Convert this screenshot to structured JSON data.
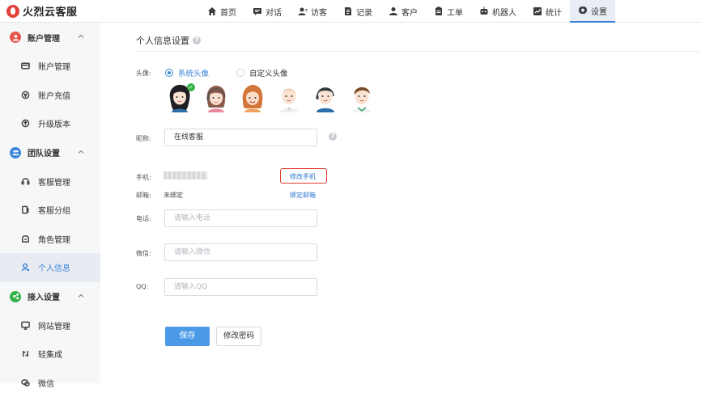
{
  "app": {
    "name": "火烈云客服"
  },
  "nav": [
    {
      "id": "home",
      "label": "首页",
      "icon": "home-icon"
    },
    {
      "id": "chat",
      "label": "对话",
      "icon": "chat-icon"
    },
    {
      "id": "visitor",
      "label": "访客",
      "icon": "visitor-icon"
    },
    {
      "id": "record",
      "label": "记录",
      "icon": "record-icon"
    },
    {
      "id": "customer",
      "label": "客户",
      "icon": "customer-icon"
    },
    {
      "id": "ticket",
      "label": "工单",
      "icon": "ticket-icon"
    },
    {
      "id": "robot",
      "label": "机器人",
      "icon": "robot-icon"
    },
    {
      "id": "stats",
      "label": "统计",
      "icon": "stats-icon"
    },
    {
      "id": "settings",
      "label": "设置",
      "icon": "gear-icon",
      "active": true
    }
  ],
  "sidebar": {
    "groups": [
      {
        "label": "账户管理",
        "icon": "account-icon",
        "color": "#e8574d",
        "items": [
          {
            "label": "账户管理",
            "icon": "card-icon"
          },
          {
            "label": "账户充值",
            "icon": "recharge-icon"
          },
          {
            "label": "升级版本",
            "icon": "upgrade-icon"
          }
        ]
      },
      {
        "label": "团队设置",
        "icon": "team-icon",
        "color": "#3b85d8",
        "items": [
          {
            "label": "客服管理",
            "icon": "headset-icon"
          },
          {
            "label": "客服分组",
            "icon": "group-icon"
          },
          {
            "label": "角色管理",
            "icon": "role-icon"
          },
          {
            "label": "个人信息",
            "icon": "person-icon",
            "active": true
          }
        ]
      },
      {
        "label": "接入设置",
        "icon": "access-icon",
        "color": "#35b34a",
        "items": [
          {
            "label": "网站管理",
            "icon": "website-icon"
          },
          {
            "label": "轻集成",
            "icon": "integration-icon"
          },
          {
            "label": "微信",
            "icon": "wechat-icon"
          }
        ]
      }
    ]
  },
  "page": {
    "title": "个人信息设置",
    "avatar_label": "头像:",
    "avatar_options": {
      "system": "系统头像",
      "custom": "自定义头像"
    },
    "avatars": [
      "avatar-1",
      "avatar-2",
      "avatar-3",
      "avatar-4",
      "avatar-5",
      "avatar-6"
    ],
    "nickname_label": "昵称:",
    "nickname_value": "在线客服",
    "phone_label": "手机:",
    "change_phone_link": "修改手机",
    "email_label": "邮箱:",
    "email_value": "未绑定",
    "bind_email_link": "绑定邮箱",
    "tel_label": "电话:",
    "tel_placeholder": "请输入电话",
    "wechat_label": "微信:",
    "wechat_placeholder": "请输入微信",
    "qq_label": "QQ:",
    "qq_placeholder": "请输入QQ",
    "save_button": "保存",
    "change_password_button": "修改密码"
  },
  "colors": {
    "accent": "#3b85d8",
    "primary_button": "#4a9ae8",
    "highlight_box": "#e03c31",
    "selected_check": "#35b34a"
  }
}
